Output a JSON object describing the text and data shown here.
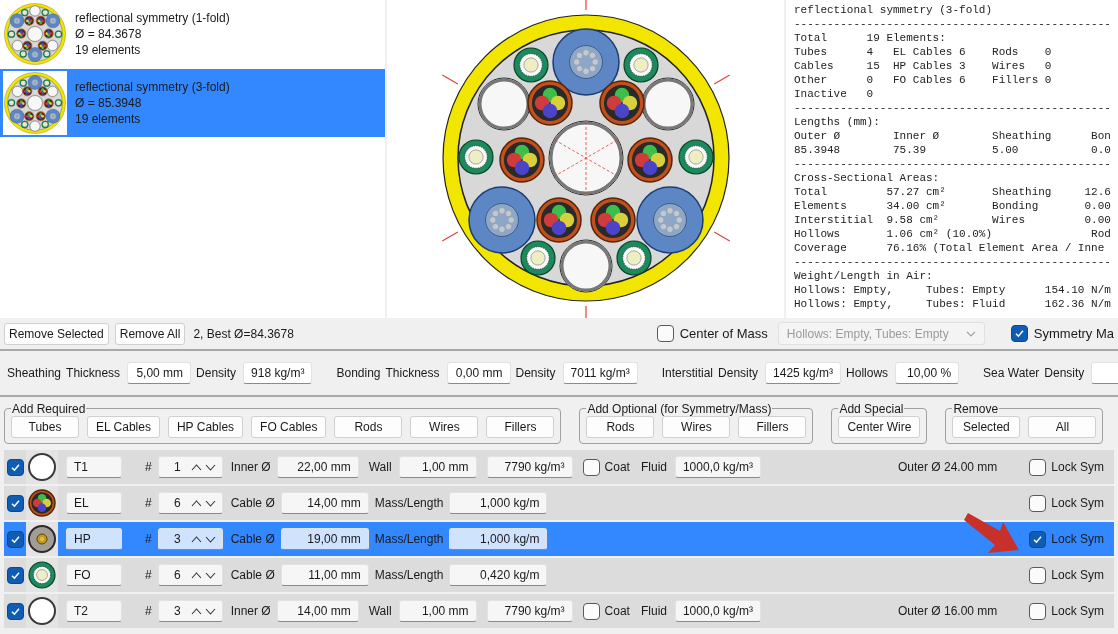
{
  "solutions": [
    {
      "title": "reflectional symmetry (1-fold)",
      "diameter": "Ø = 84.3678",
      "elements": "19 elements",
      "selected": false
    },
    {
      "title": "reflectional symmetry (3-fold)",
      "diameter": "Ø = 85.3948",
      "elements": "19 elements",
      "selected": true
    }
  ],
  "report_lines": [
    "reflectional symmetry (3-fold)",
    "------------------------------------------------",
    "Total      19 Elements:",
    "Tubes      4   EL Cables 6    Rods    0",
    "Cables     15  HP Cables 3    Wires   0",
    "Other      0   FO Cables 6    Fillers 0",
    "Inactive   0",
    "------------------------------------------------",
    "Lengths (mm):",
    "Outer Ø        Inner Ø        Sheathing      Bon",
    "85.3948        75.39          5.00           0.0",
    "------------------------------------------------",
    "Cross-Sectional Areas:",
    "Total         57.27 cm²       Sheathing     12.6",
    "Elements      34.00 cm²       Bonding       0.00",
    "Interstitial  9.58 cm²        Wires         0.00",
    "Hollows       1.06 cm² (10.0%)               Rod",
    "Coverage      76.16% (Total Element Area / Inne",
    "------------------------------------------------",
    "Weight/Length in Air:",
    "Hollows: Empty,     Tubes: Empty      154.10 N/m",
    "Hollows: Empty,     Tubes: Fluid      162.36 N/m"
  ],
  "toolbar": {
    "buttons": [
      "Remove Selected",
      "Remove All"
    ],
    "status": "2, Best Ø=84.3678",
    "center_of_mass": {
      "label": "Center of Mass",
      "checked": false
    },
    "dropdown": {
      "value": "Hollows: Empty, Tubes: Empty",
      "disabled": true
    },
    "symmetry": {
      "label": "Symmetry Ma",
      "checked": true
    }
  },
  "settings_groups": [
    [
      {
        "kind": "label",
        "text": "Sheathing"
      },
      {
        "kind": "label",
        "text": "Thickness"
      },
      {
        "kind": "field",
        "value": "5,00 mm"
      },
      {
        "kind": "label",
        "text": "Density"
      },
      {
        "kind": "field",
        "value": "918 kg/m³"
      }
    ],
    [
      {
        "kind": "label",
        "text": "Bonding"
      },
      {
        "kind": "label",
        "text": "Thickness"
      },
      {
        "kind": "field",
        "value": "0,00 mm"
      },
      {
        "kind": "label",
        "text": "Density"
      },
      {
        "kind": "field",
        "value": "7011 kg/m³"
      }
    ],
    [
      {
        "kind": "label",
        "text": "Interstitial"
      },
      {
        "kind": "label",
        "text": "Density"
      },
      {
        "kind": "field",
        "value": "1425 kg/m³"
      },
      {
        "kind": "label",
        "text": "Hollows"
      },
      {
        "kind": "field",
        "value": "10,00 %"
      }
    ],
    [
      {
        "kind": "label",
        "text": "Sea Water"
      },
      {
        "kind": "label",
        "text": "Density"
      },
      {
        "kind": "field"
      }
    ]
  ],
  "add_groups": [
    {
      "title": "Add Required",
      "buttons": [
        "Tubes",
        "EL Cables",
        "HP Cables",
        "FO Cables",
        "Rods",
        "Wires",
        "Fillers"
      ]
    },
    {
      "title": "Add Optional (for Symmetry/Mass)",
      "buttons": [
        "Rods",
        "Wires",
        "Fillers"
      ]
    },
    {
      "title": "Add Special",
      "buttons": [
        "Center Wire"
      ]
    },
    {
      "title": "Remove",
      "buttons": [
        "Selected",
        "All"
      ]
    }
  ],
  "elements": [
    {
      "kind": "tube",
      "active": true,
      "name": "T1",
      "count_label": "#",
      "count": "1",
      "diameter_label": "Inner Ø",
      "diameter": "22,00 mm",
      "wall_label": "Wall",
      "wall": "1,00 mm",
      "density": "7790 kg/m³",
      "coat_label": "Coat",
      "coat": false,
      "fluid_label": "Fluid",
      "fluid": "1000,0 kg/m³",
      "outer": "Outer Ø 24.00 mm",
      "lock_label": "Lock Sym",
      "lock": false,
      "selected": false
    },
    {
      "kind": "el",
      "active": true,
      "name": "EL",
      "count_label": "#",
      "count": "6",
      "diameter_label": "Cable Ø",
      "diameter": "14,00 mm",
      "mass_label": "Mass/Length",
      "mass": "1,000 kg/m",
      "lock_label": "Lock Sym",
      "lock": false,
      "selected": false
    },
    {
      "kind": "hp",
      "active": true,
      "name": "HP",
      "count_label": "#",
      "count": "3",
      "diameter_label": "Cable Ø",
      "diameter": "19,00 mm",
      "mass_label": "Mass/Length",
      "mass": "1,000 kg/m",
      "lock_label": "Lock Sym",
      "lock": true,
      "selected": true
    },
    {
      "kind": "fo",
      "active": true,
      "name": "FO",
      "count_label": "#",
      "count": "6",
      "diameter_label": "Cable Ø",
      "diameter": "11,00 mm",
      "mass_label": "Mass/Length",
      "mass": "0,420 kg/m",
      "lock_label": "Lock Sym",
      "lock": false,
      "selected": false
    },
    {
      "kind": "tube",
      "active": true,
      "name": "T2",
      "count_label": "#",
      "count": "3",
      "diameter_label": "Inner Ø",
      "diameter": "14,00 mm",
      "wall_label": "Wall",
      "wall": "1,00 mm",
      "density": "7790 kg/m³",
      "coat_label": "Coat",
      "coat": false,
      "fluid_label": "Fluid",
      "fluid": "1000,0 kg/m³",
      "outer": "Outer Ø 16.00 mm",
      "lock_label": "Lock Sym",
      "lock": false,
      "selected": false
    }
  ]
}
